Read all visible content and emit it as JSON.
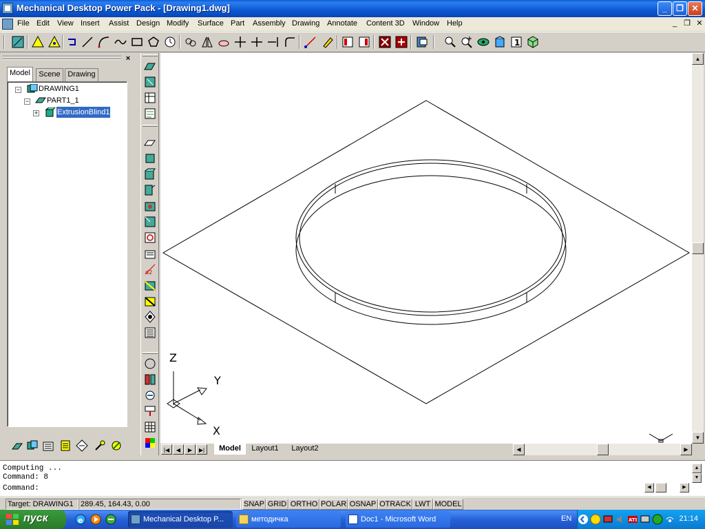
{
  "window": {
    "title": "Mechanical Desktop Power Pack - [Drawing1.dwg]",
    "min": "_",
    "max": "❐",
    "close": "✕"
  },
  "menu": {
    "items": [
      "File",
      "Edit",
      "View",
      "Insert",
      "Assist",
      "Design",
      "Modify",
      "Surface",
      "Part",
      "Assembly",
      "Drawing",
      "Annotate",
      "Content 3D",
      "Window",
      "Help"
    ],
    "mdi_min": "_",
    "mdi_restore": "❐",
    "mdi_close": "✕"
  },
  "browser": {
    "close": "×",
    "tabs": [
      "Model",
      "Scene",
      "Drawing"
    ],
    "active_tab": "Model",
    "tree": [
      {
        "label": "DRAWING1",
        "expander": "−"
      },
      {
        "label": "PART1_1",
        "expander": "−"
      },
      {
        "label": "ExtrusionBlind1",
        "expander": "+"
      }
    ]
  },
  "viewport": {
    "ucs_z": "Z",
    "ucs_y": "Y",
    "ucs_x": "X"
  },
  "layout_tabs": [
    "Model",
    "Layout1",
    "Layout2"
  ],
  "layout_nav": [
    "|◀",
    "◀",
    "▶",
    "▶|"
  ],
  "scroll_arrows": {
    "up": "▲",
    "down": "▼",
    "left": "◀",
    "right": "▶"
  },
  "command": {
    "lines": [
      "Computing ...",
      "Command: 8",
      "Command:"
    ]
  },
  "status": {
    "target": "Target: DRAWING1",
    "coords": "289.45, 164.43, 0.00",
    "toggles": [
      "SNAP",
      "GRID",
      "ORTHO",
      "POLAR",
      "OSNAP",
      "OTRACK",
      "LWT",
      "MODEL"
    ]
  },
  "taskbar": {
    "start": "пуск",
    "tasks": [
      {
        "label": "Mechanical Desktop P...",
        "active": true
      },
      {
        "label": "методичка",
        "active": false
      },
      {
        "label": "Doc1 - Microsoft Word",
        "active": false
      }
    ],
    "lang": "EN",
    "clock": "21:14"
  },
  "colors": {
    "titlebar": "#0a5fd6",
    "selection": "#316ac5",
    "taskbar": "#2662d8",
    "start": "#318b31"
  },
  "icons": {
    "toolbar": [
      "ucs-icon",
      "warning-triangle-icon",
      "warning-triangle-icon",
      "undo-icon",
      "line-icon",
      "arc-icon",
      "spline-icon",
      "rectangle-icon",
      "polygon-icon",
      "clock-icon",
      "copy-icon",
      "mirror-icon",
      "erase-icon",
      "move-icon",
      "trim-icon",
      "extend-icon",
      "fillet-icon",
      "dimension-icon",
      "pencil-icon",
      "properties-icon",
      "properties-icon",
      "render-icon",
      "render-icon",
      "layer-icon",
      "zoom-icon",
      "zoom-window-icon",
      "view-icon",
      "orbit-icon",
      "info-icon",
      "3d-box-icon"
    ],
    "vertical": [
      "sketch-icon",
      "profile-icon",
      "constraint-icon",
      "workplane-icon",
      "extrude-icon",
      "revolve-icon",
      "sweep-icon",
      "loft-icon",
      "hole-icon",
      "fillet-feature-icon",
      "chamfer-icon",
      "shell-icon",
      "dimension-feature-icon",
      "draft-icon",
      "split-icon",
      "mass-icon",
      "assembly-icon",
      "constraint-assembly-icon",
      "explode-icon",
      "bom-icon",
      "balloon-icon",
      "color-grid-icon"
    ],
    "browser_tools": [
      "sketch-icon",
      "part-icon",
      "folder-icon",
      "table-icon",
      "3d-view-icon",
      "update-icon",
      "pin-icon"
    ]
  }
}
